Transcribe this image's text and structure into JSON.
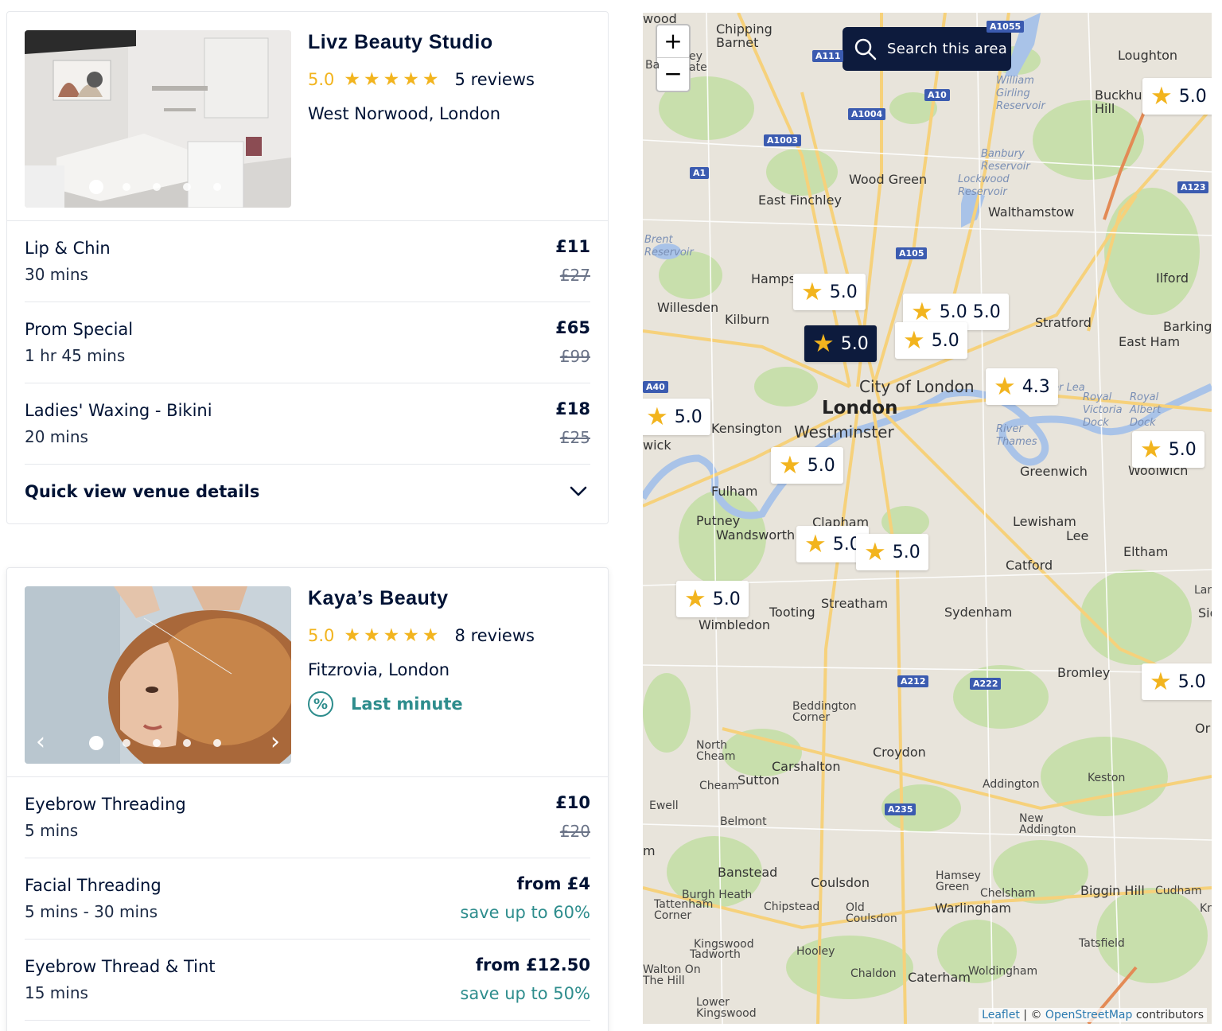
{
  "venues": [
    {
      "name": "Livz Beauty Studio",
      "rating": "5.0",
      "reviews": "5 reviews",
      "location": "West Norwood, London",
      "photo_dots": 5,
      "services": [
        {
          "name": "Lip & Chin",
          "duration": "30 mins",
          "price": "£11",
          "old_price": "£27"
        },
        {
          "name": "Prom Special",
          "duration": "1 hr 45 mins",
          "price": "£65",
          "old_price": "£99"
        },
        {
          "name": "Ladies' Waxing - Bikini",
          "duration": "20 mins",
          "price": "£18",
          "old_price": "£25"
        }
      ],
      "quick_view": "Quick view venue details"
    },
    {
      "name": "Kaya’s Beauty",
      "rating": "5.0",
      "reviews": "8 reviews",
      "location": "Fitzrovia, London",
      "badge": {
        "icon": "percent-icon",
        "label": "Last minute"
      },
      "photo_dots": 5,
      "services": [
        {
          "name": "Eyebrow Threading",
          "duration": "5 mins",
          "price": "£10",
          "old_price": "£20"
        },
        {
          "name": "Facial Threading",
          "duration": "5 mins - 30 mins",
          "price": "from £4",
          "save": "save up to 60%"
        },
        {
          "name": "Eyebrow Thread & Tint",
          "duration": "15 mins",
          "price": "from £12.50",
          "save": "save up to 50%"
        }
      ]
    }
  ],
  "map": {
    "zoom_in": "+",
    "zoom_out": "−",
    "search_button": "Search this area",
    "pins": [
      "5.0",
      "5.0",
      "5.0 5.0",
      "5.0",
      "5.0",
      "4.3",
      "5.0",
      "5.0",
      "5.0",
      "5.0",
      "5.0",
      "5.0",
      "5.0"
    ],
    "places": {
      "chipping_barnet": "Chipping\nBarnet",
      "loughton": "Loughton",
      "buckhurst_hill": "Buckhur\nHill",
      "wood_green": "Wood Green",
      "east_finchley": "East Finchley",
      "walthamstow": "Walthamstow",
      "hampstead": "Hamps",
      "willesden": "Willesden",
      "kilburn": "Kilburn",
      "ilford": "Ilford",
      "stratford": "Stratford",
      "barking": "Barking",
      "east_ham": "East Ham",
      "city_of_london": "City of London",
      "london": "London",
      "westminster": "Westminster",
      "kensington": "Kensington",
      "greenwich": "Greenwich",
      "woolwich": "Woolwich",
      "fulham": "Fulham",
      "putney": "Putney",
      "wandsworth": "Wandsworth",
      "clapham": "Clapham",
      "lewisham": "Lewisham",
      "lee": "Lee",
      "eltham": "Eltham",
      "catford": "Catford",
      "tooting": "Tooting",
      "streatham": "Streatham",
      "sydenham": "Sydenham",
      "wimbledon": "Wimbledon",
      "bromley": "Bromley",
      "beddington": "Beddington\nCorner",
      "north_cheam": "North\nCheam",
      "croydon": "Croydon",
      "carshalton": "Carshalton",
      "cheam": "Cheam",
      "sutton": "Sutton",
      "addington": "Addington",
      "keston": "Keston",
      "ewell": "Ewell",
      "belmont": "Belmont",
      "new_addington": "New\nAddington",
      "banstead": "Banstead",
      "coulsdon": "Coulsdon",
      "hamsey_green": "Hamsey\nGreen",
      "chelsham": "Chelsham",
      "warlingham": "Warlingham",
      "biggin_hill": "Biggin Hill",
      "cudham": "Cudham",
      "burgh_heath": "Burgh Heath",
      "tattenham": "Tattenham\nCorner",
      "chipstead": "Chipstead",
      "old_coulsdon": "Old\nCoulsdon",
      "kingswood": "Kingswood",
      "tadworth": "Tadworth",
      "hooley": "Hooley",
      "tatsfield": "Tatsfield",
      "walton": "Walton On\nThe Hill",
      "chaldon": "Chaldon",
      "caterham": "Caterham",
      "woldingham": "Woldingham",
      "lower_kingswood": "Lower\nKingswood",
      "wood": "wood",
      "ba": "Ba",
      "ate": "ey\nate",
      "wick": "wick",
      "lan": "Lan",
      "sid": "Sid",
      "orp": "Or",
      "kr": "Kr",
      "m": "m"
    },
    "water": {
      "william_girling": "William\nGirling\nReservoir",
      "banbury": "Banbury\nReservoir",
      "lockwood": "Lockwood\nReservoir",
      "brent": "Brent\nReservoir",
      "river_thames": "River\nThames",
      "royal_victoria": "Royal\nVictoria\nDock",
      "royal_albert": "Royal\nAlbert\nDock",
      "river_lea": "er Lea"
    },
    "roads": [
      "A1055",
      "A111",
      "A10",
      "A1004",
      "A1003",
      "A1",
      "A105",
      "A123",
      "A40",
      "A212",
      "A222",
      "A235"
    ],
    "attribution": {
      "leaflet": "Leaflet",
      "sep": " | © ",
      "osm": "OpenStreetMap",
      "contrib": " contributors"
    }
  }
}
